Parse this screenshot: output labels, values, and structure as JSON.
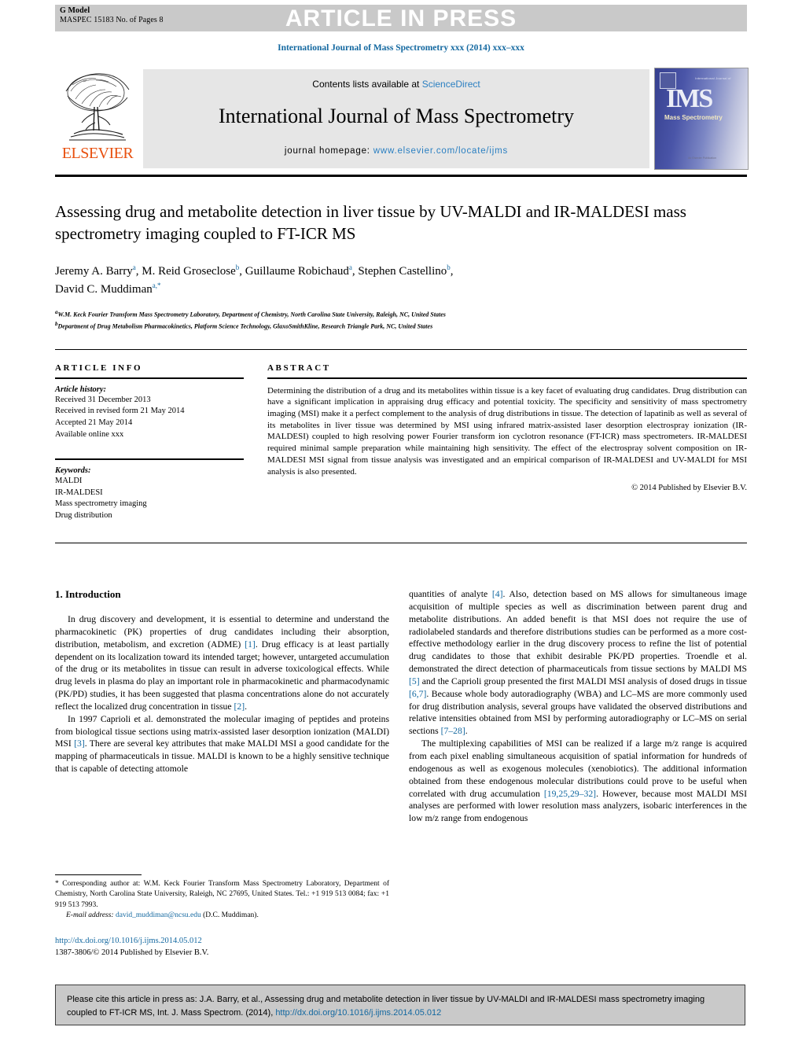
{
  "banner": {
    "gmodel_label": "G Model",
    "manuscript_id": "MASPEC 15183 No. of Pages 8",
    "status_text": "ARTICLE IN PRESS"
  },
  "running_head": "International Journal of Mass Spectrometry xxx (2014) xxx–xxx",
  "masthead": {
    "publisher": "ELSEVIER",
    "contents_prefix": "Contents lists available at ",
    "contents_link": "ScienceDirect",
    "journal_title": "International Journal of Mass Spectrometry",
    "homepage_label": "journal homepage: ",
    "homepage_url": "www.elsevier.com/locate/ijms",
    "cover": {
      "top_text": "International Journal of",
      "logo_text": "IMS",
      "subtitle": "Mass Spectrometry",
      "bottom_text": "An Elsevier Publication"
    }
  },
  "article": {
    "title": "Assessing drug and metabolite detection in liver tissue by UV-MALDI and IR-MALDESI mass spectrometry imaging coupled to FT-ICR MS",
    "authors": [
      {
        "name": "Jeremy A. Barry",
        "marks": "a"
      },
      {
        "name": "M. Reid Groseclose",
        "marks": "b"
      },
      {
        "name": "Guillaume Robichaud",
        "marks": "a"
      },
      {
        "name": "Stephen Castellino",
        "marks": "b"
      },
      {
        "name": "David C. Muddiman",
        "marks": "a,*"
      }
    ],
    "affiliations": [
      {
        "mark": "a",
        "text": "W.M. Keck Fourier Transform Mass Spectrometry Laboratory, Department of Chemistry, North Carolina State University, Raleigh, NC, United States"
      },
      {
        "mark": "b",
        "text": "Department of Drug Metabolism Pharmacokinetics, Platform Science Technology, GlaxoSmithKline, Research Triangle Park, NC, United States"
      }
    ]
  },
  "article_info": {
    "heading": "ARTICLE INFO",
    "history_label": "Article history:",
    "history": [
      "Received 31 December 2013",
      "Received in revised form 21 May 2014",
      "Accepted 21 May 2014",
      "Available online xxx"
    ],
    "keywords_label": "Keywords:",
    "keywords": [
      "MALDI",
      "IR-MALDESI",
      "Mass spectrometry imaging",
      "Drug distribution"
    ]
  },
  "abstract": {
    "heading": "ABSTRACT",
    "text": "Determining the distribution of a drug and its metabolites within tissue is a key facet of evaluating drug candidates. Drug distribution can have a significant implication in appraising drug efficacy and potential toxicity. The specificity and sensitivity of mass spectrometry imaging (MSI) make it a perfect complement to the analysis of drug distributions in tissue. The detection of lapatinib as well as several of its metabolites in liver tissue was determined by MSI using infrared matrix-assisted laser desorption electrospray ionization (IR-MALDESI) coupled to high resolving power Fourier transform ion cyclotron resonance (FT-ICR) mass spectrometers. IR-MALDESI required minimal sample preparation while maintaining high sensitivity. The effect of the electrospray solvent composition on IR-MALDESI MSI signal from tissue analysis was investigated and an empirical comparison of IR-MALDESI and UV-MALDI for MSI analysis is also presented.",
    "copyright": "© 2014 Published by Elsevier B.V."
  },
  "body": {
    "section_heading": "1. Introduction",
    "left_paragraphs": [
      "In drug discovery and development, it is essential to determine and understand the pharmacokinetic (PK) properties of drug candidates including their absorption, distribution, metabolism, and excretion (ADME) [1]. Drug efficacy is at least partially dependent on its localization toward its intended target; however, untargeted accumulation of the drug or its metabolites in tissue can result in adverse toxicological effects. While drug levels in plasma do play an important role in pharmacokinetic and pharmacodynamic (PK/PD) studies, it has been suggested that plasma concentrations alone do not accurately reflect the localized drug concentration in tissue [2].",
      "In 1997 Caprioli et al. demonstrated the molecular imaging of peptides and proteins from biological tissue sections using matrix-assisted laser desorption ionization (MALDI) MSI [3]. There are several key attributes that make MALDI MSI a good candidate for the mapping of pharmaceuticals in tissue. MALDI is known to be a highly sensitive technique that is capable of detecting attomole"
    ],
    "right_paragraphs": [
      "quantities of analyte [4]. Also, detection based on MS allows for simultaneous image acquisition of multiple species as well as discrimination between parent drug and metabolite distributions. An added benefit is that MSI does not require the use of radiolabeled standards and therefore distributions studies can be performed as a more cost-effective methodology earlier in the drug discovery process to refine the list of potential drug candidates to those that exhibit desirable PK/PD properties. Troendle et al. demonstrated the direct detection of pharmaceuticals from tissue sections by MALDI MS [5] and the Caprioli group presented the first MALDI MSI analysis of dosed drugs in tissue [6,7]. Because whole body autoradiography (WBA) and LC–MS are more commonly used for drug distribution analysis, several groups have validated the observed distributions and relative intensities obtained from MSI by performing autoradiography or LC–MS on serial sections [7–28].",
      "The multiplexing capabilities of MSI can be realized if a large m/z range is acquired from each pixel enabling simultaneous acquisition of spatial information for hundreds of endogenous as well as exogenous molecules (xenobiotics). The additional information obtained from these endogenous molecular distributions could prove to be useful when correlated with drug accumulation [19,25,29–32]. However, because most MALDI MSI analyses are performed with lower resolution mass analyzers, isobaric interferences in the low m/z range from endogenous"
    ]
  },
  "footnotes": {
    "corresponding": "* Corresponding author at: W.M. Keck Fourier Transform Mass Spectrometry Laboratory, Department of Chemistry, North Carolina State University, Raleigh, NC 27695, United States. Tel.: +1 919 513 0084; fax: +1 919 513 7993.",
    "email_label": "E-mail address:",
    "email": "david_muddiman@ncsu.edu",
    "email_suffix": "(D.C. Muddiman).",
    "doi_url": "http://dx.doi.org/10.1016/j.ijms.2014.05.012",
    "issn_line": "1387-3806/© 2014 Published by Elsevier B.V."
  },
  "cite_box": {
    "prefix": "Please cite this article in press as: J.A. Barry, et al., Assessing drug and metabolite detection in liver tissue by UV-MALDI and IR-MALDESI mass spectrometry imaging coupled to FT-ICR MS, Int. J. Mass Spectrom. (2014), ",
    "link": "http://dx.doi.org/10.1016/j.ijms.2014.05.012"
  },
  "colors": {
    "link_blue": "#1368a0",
    "sciencedirect_blue": "#2a7fc1",
    "elsevier_orange": "#e8500f",
    "banner_gray": "#c9c9c9",
    "masthead_gray": "#e6e6e6"
  }
}
